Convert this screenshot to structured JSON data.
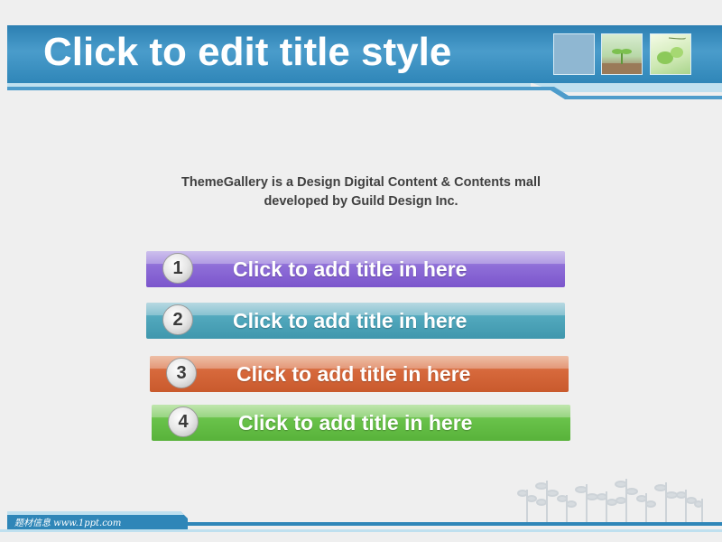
{
  "header": {
    "title": "Click to edit title style"
  },
  "body": {
    "line1": "ThemeGallery is a Design Digital Content & Contents mall",
    "line2": "developed by Guild Design Inc."
  },
  "items": [
    {
      "number": "1",
      "label": "Click to add title in here",
      "color": "#7b55cc"
    },
    {
      "number": "2",
      "label": "Click to add title in here",
      "color": "#3f97ad"
    },
    {
      "number": "3",
      "label": "Click to add title in here",
      "color": "#c95a2d"
    },
    {
      "number": "4",
      "label": "Click to add title in here",
      "color": "#58b23a"
    }
  ],
  "footer": {
    "text": "题材信息  www.1ppt.com"
  },
  "colors": {
    "header_blue": "#2c7fb2",
    "background": "#efefef"
  }
}
